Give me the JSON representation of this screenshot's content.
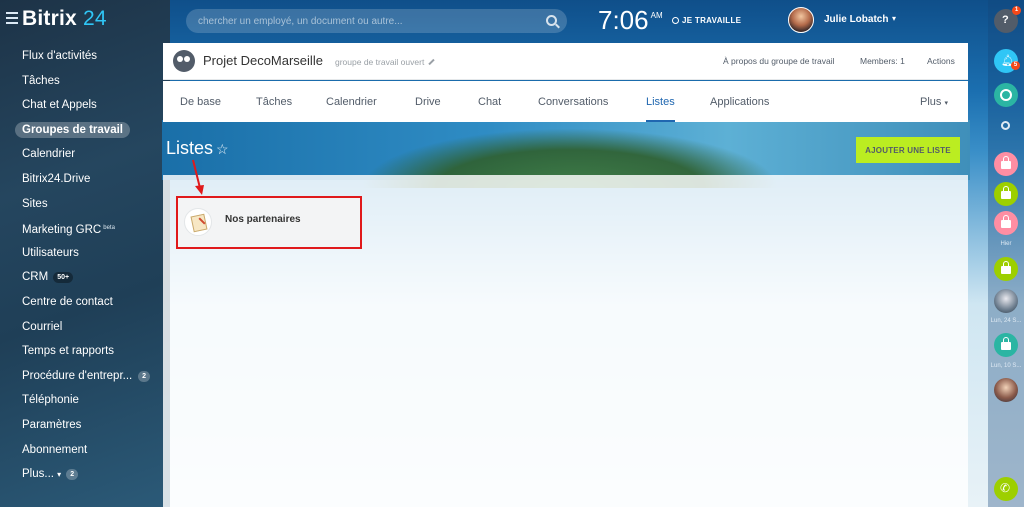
{
  "header": {
    "logo_text": "Bitrix",
    "logo_number": "24",
    "search_placeholder": "chercher un employé, un document ou autre...",
    "clock_time": "7:06",
    "clock_ampm": "AM",
    "work_status": "JE TRAVAILLE",
    "user_name": "Julie Lobatch"
  },
  "sidebar": {
    "items": [
      {
        "label": "Flux d'activités"
      },
      {
        "label": "Tâches"
      },
      {
        "label": "Chat et Appels"
      },
      {
        "label": "Groupes de travail",
        "active": true
      },
      {
        "label": "Calendrier"
      },
      {
        "label": "Bitrix24.Drive"
      },
      {
        "label": "Sites"
      },
      {
        "label": "Marketing GRC",
        "sup": "beta"
      },
      {
        "label": "Utilisateurs"
      },
      {
        "label": "CRM",
        "badge": "50+"
      },
      {
        "label": "Centre de contact"
      },
      {
        "label": "Courriel"
      },
      {
        "label": "Temps et rapports"
      },
      {
        "label": "Procédure d'entrepr...",
        "badge_right": "2"
      },
      {
        "label": "Téléphonie"
      },
      {
        "label": "Paramètres"
      },
      {
        "label": "Abonnement"
      },
      {
        "label": "Plus...",
        "badge": "2"
      }
    ]
  },
  "group": {
    "title": "Projet DecoMarseille",
    "type": "groupe de travail ouvert",
    "about": "À propos du groupe de travail",
    "members": "Members: 1",
    "actions": "Actions"
  },
  "tabs": [
    {
      "label": "De base"
    },
    {
      "label": "Tâches"
    },
    {
      "label": "Calendrier"
    },
    {
      "label": "Drive"
    },
    {
      "label": "Chat"
    },
    {
      "label": "Conversations"
    },
    {
      "label": "Listes",
      "active": true
    },
    {
      "label": "Applications"
    },
    {
      "label": "Plus"
    }
  ],
  "page": {
    "title": "Listes",
    "add_button": "AJOUTER UNE LISTE",
    "lists": [
      {
        "label": "Nos partenaires"
      }
    ]
  },
  "dock": {
    "help_badge": "1",
    "notif_badge": "5",
    "label_yesterday": "Hier",
    "label_date1": "Lun, 24 S...",
    "label_date2": "Lun, 10 S..."
  },
  "colors": {
    "accent_blue": "#2067b0",
    "add_button_green": "#bbed21",
    "annotation_red": "#e0191b"
  }
}
